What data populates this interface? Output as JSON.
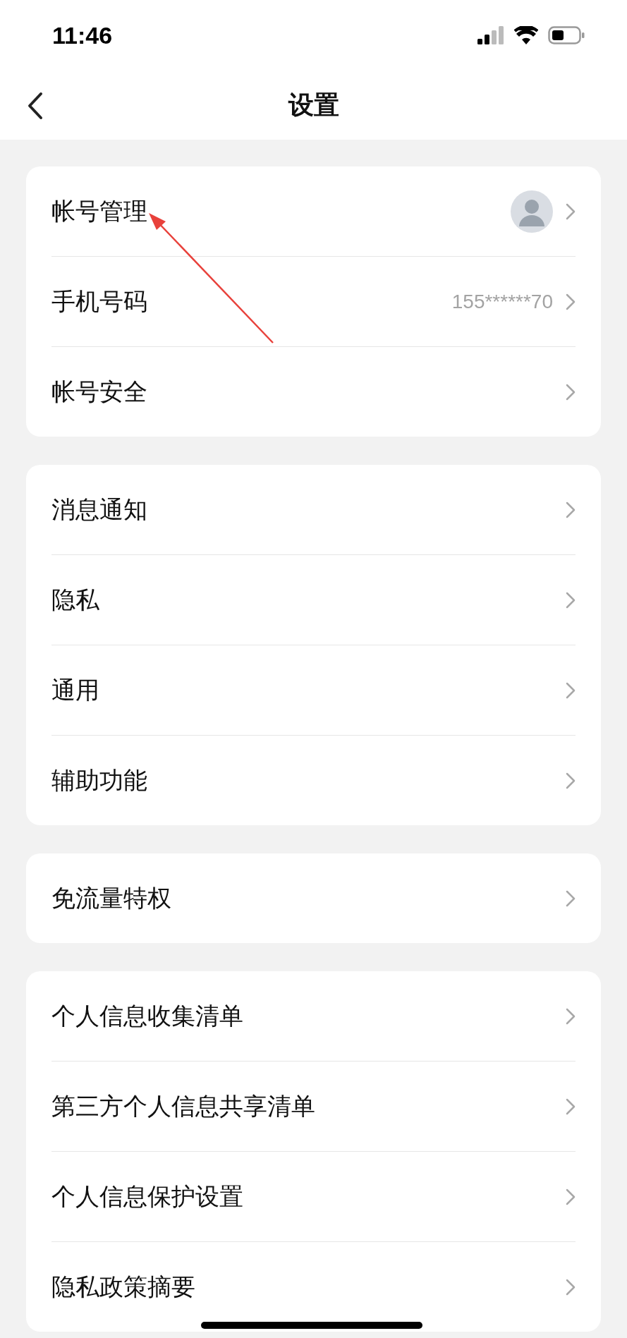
{
  "status_bar": {
    "time": "11:46"
  },
  "nav": {
    "title": "设置"
  },
  "groups": [
    {
      "rows": [
        {
          "kind": "avatar",
          "label": "帐号管理"
        },
        {
          "kind": "value",
          "label": "手机号码",
          "value": "155******70"
        },
        {
          "kind": "plain",
          "label": "帐号安全"
        }
      ]
    },
    {
      "rows": [
        {
          "kind": "plain",
          "label": "消息通知"
        },
        {
          "kind": "plain",
          "label": "隐私"
        },
        {
          "kind": "plain",
          "label": "通用"
        },
        {
          "kind": "plain",
          "label": "辅助功能"
        }
      ]
    },
    {
      "rows": [
        {
          "kind": "plain",
          "label": "免流量特权"
        }
      ]
    },
    {
      "rows": [
        {
          "kind": "plain",
          "label": "个人信息收集清单"
        },
        {
          "kind": "plain",
          "label": "第三方个人信息共享清单"
        },
        {
          "kind": "plain",
          "label": "个人信息保护设置"
        },
        {
          "kind": "plain",
          "label": "隐私政策摘要"
        }
      ]
    }
  ]
}
